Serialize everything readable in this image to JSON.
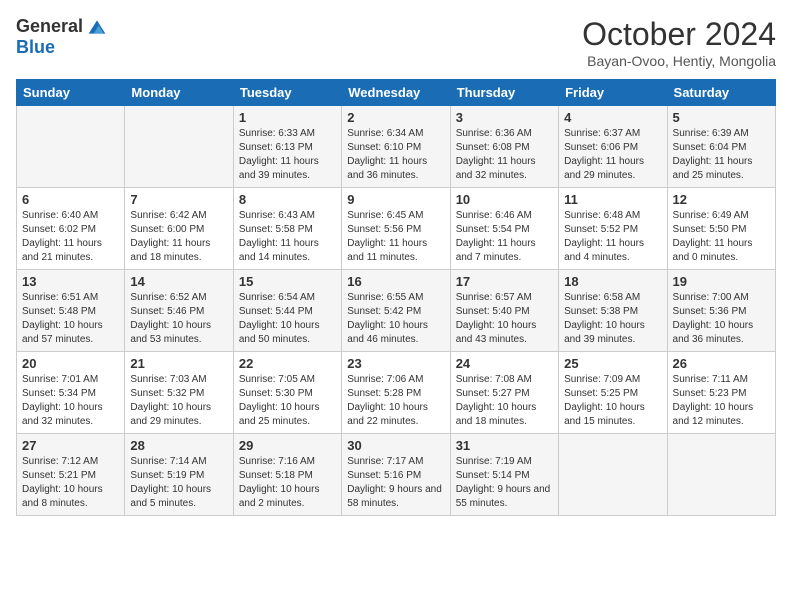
{
  "header": {
    "logo": {
      "general": "General",
      "blue": "Blue"
    },
    "title": "October 2024",
    "subtitle": "Bayan-Ovoo, Hentiy, Mongolia"
  },
  "days_of_week": [
    "Sunday",
    "Monday",
    "Tuesday",
    "Wednesday",
    "Thursday",
    "Friday",
    "Saturday"
  ],
  "weeks": [
    [
      {
        "day": "",
        "info": ""
      },
      {
        "day": "",
        "info": ""
      },
      {
        "day": "1",
        "info": "Sunrise: 6:33 AM\nSunset: 6:13 PM\nDaylight: 11 hours and 39 minutes."
      },
      {
        "day": "2",
        "info": "Sunrise: 6:34 AM\nSunset: 6:10 PM\nDaylight: 11 hours and 36 minutes."
      },
      {
        "day": "3",
        "info": "Sunrise: 6:36 AM\nSunset: 6:08 PM\nDaylight: 11 hours and 32 minutes."
      },
      {
        "day": "4",
        "info": "Sunrise: 6:37 AM\nSunset: 6:06 PM\nDaylight: 11 hours and 29 minutes."
      },
      {
        "day": "5",
        "info": "Sunrise: 6:39 AM\nSunset: 6:04 PM\nDaylight: 11 hours and 25 minutes."
      }
    ],
    [
      {
        "day": "6",
        "info": "Sunrise: 6:40 AM\nSunset: 6:02 PM\nDaylight: 11 hours and 21 minutes."
      },
      {
        "day": "7",
        "info": "Sunrise: 6:42 AM\nSunset: 6:00 PM\nDaylight: 11 hours and 18 minutes."
      },
      {
        "day": "8",
        "info": "Sunrise: 6:43 AM\nSunset: 5:58 PM\nDaylight: 11 hours and 14 minutes."
      },
      {
        "day": "9",
        "info": "Sunrise: 6:45 AM\nSunset: 5:56 PM\nDaylight: 11 hours and 11 minutes."
      },
      {
        "day": "10",
        "info": "Sunrise: 6:46 AM\nSunset: 5:54 PM\nDaylight: 11 hours and 7 minutes."
      },
      {
        "day": "11",
        "info": "Sunrise: 6:48 AM\nSunset: 5:52 PM\nDaylight: 11 hours and 4 minutes."
      },
      {
        "day": "12",
        "info": "Sunrise: 6:49 AM\nSunset: 5:50 PM\nDaylight: 11 hours and 0 minutes."
      }
    ],
    [
      {
        "day": "13",
        "info": "Sunrise: 6:51 AM\nSunset: 5:48 PM\nDaylight: 10 hours and 57 minutes."
      },
      {
        "day": "14",
        "info": "Sunrise: 6:52 AM\nSunset: 5:46 PM\nDaylight: 10 hours and 53 minutes."
      },
      {
        "day": "15",
        "info": "Sunrise: 6:54 AM\nSunset: 5:44 PM\nDaylight: 10 hours and 50 minutes."
      },
      {
        "day": "16",
        "info": "Sunrise: 6:55 AM\nSunset: 5:42 PM\nDaylight: 10 hours and 46 minutes."
      },
      {
        "day": "17",
        "info": "Sunrise: 6:57 AM\nSunset: 5:40 PM\nDaylight: 10 hours and 43 minutes."
      },
      {
        "day": "18",
        "info": "Sunrise: 6:58 AM\nSunset: 5:38 PM\nDaylight: 10 hours and 39 minutes."
      },
      {
        "day": "19",
        "info": "Sunrise: 7:00 AM\nSunset: 5:36 PM\nDaylight: 10 hours and 36 minutes."
      }
    ],
    [
      {
        "day": "20",
        "info": "Sunrise: 7:01 AM\nSunset: 5:34 PM\nDaylight: 10 hours and 32 minutes."
      },
      {
        "day": "21",
        "info": "Sunrise: 7:03 AM\nSunset: 5:32 PM\nDaylight: 10 hours and 29 minutes."
      },
      {
        "day": "22",
        "info": "Sunrise: 7:05 AM\nSunset: 5:30 PM\nDaylight: 10 hours and 25 minutes."
      },
      {
        "day": "23",
        "info": "Sunrise: 7:06 AM\nSunset: 5:28 PM\nDaylight: 10 hours and 22 minutes."
      },
      {
        "day": "24",
        "info": "Sunrise: 7:08 AM\nSunset: 5:27 PM\nDaylight: 10 hours and 18 minutes."
      },
      {
        "day": "25",
        "info": "Sunrise: 7:09 AM\nSunset: 5:25 PM\nDaylight: 10 hours and 15 minutes."
      },
      {
        "day": "26",
        "info": "Sunrise: 7:11 AM\nSunset: 5:23 PM\nDaylight: 10 hours and 12 minutes."
      }
    ],
    [
      {
        "day": "27",
        "info": "Sunrise: 7:12 AM\nSunset: 5:21 PM\nDaylight: 10 hours and 8 minutes."
      },
      {
        "day": "28",
        "info": "Sunrise: 7:14 AM\nSunset: 5:19 PM\nDaylight: 10 hours and 5 minutes."
      },
      {
        "day": "29",
        "info": "Sunrise: 7:16 AM\nSunset: 5:18 PM\nDaylight: 10 hours and 2 minutes."
      },
      {
        "day": "30",
        "info": "Sunrise: 7:17 AM\nSunset: 5:16 PM\nDaylight: 9 hours and 58 minutes."
      },
      {
        "day": "31",
        "info": "Sunrise: 7:19 AM\nSunset: 5:14 PM\nDaylight: 9 hours and 55 minutes."
      },
      {
        "day": "",
        "info": ""
      },
      {
        "day": "",
        "info": ""
      }
    ]
  ]
}
